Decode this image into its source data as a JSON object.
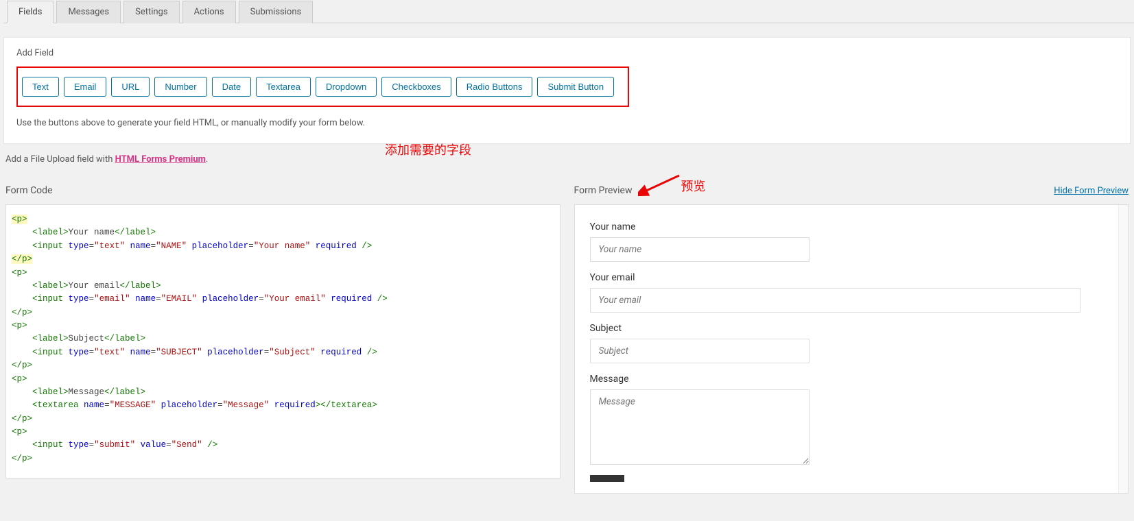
{
  "tabs": [
    "Fields",
    "Messages",
    "Settings",
    "Actions",
    "Submissions"
  ],
  "addField": {
    "title": "Add Field",
    "buttons": [
      "Text",
      "Email",
      "URL",
      "Number",
      "Date",
      "Textarea",
      "Dropdown",
      "Checkboxes",
      "Radio Buttons",
      "Submit Button"
    ],
    "hint": "Use the buttons above to generate your field HTML, or manually modify your form below.",
    "annotation": "添加需要的字段"
  },
  "uploadNote": {
    "prefix": "Add a File Upload field with ",
    "link": "HTML Forms Premium",
    "suffix": "."
  },
  "formCode": {
    "title": "Form Code",
    "code": {
      "name_label": "Your name",
      "name_placeholder": "Your name",
      "email_label": "Your email",
      "email_placeholder": "Your email",
      "subject_label": "Subject",
      "subject_placeholder": "Subject",
      "message_label": "Message",
      "message_placeholder": "Message",
      "submit_value": "Send"
    }
  },
  "formPreview": {
    "title": "Form Preview",
    "hideLink": "Hide Form Preview",
    "annotation": "预览",
    "fields": {
      "name": {
        "label": "Your name",
        "placeholder": "Your name"
      },
      "email": {
        "label": "Your email",
        "placeholder": "Your email"
      },
      "subject": {
        "label": "Subject",
        "placeholder": "Subject"
      },
      "message": {
        "label": "Message",
        "placeholder": "Message"
      }
    }
  }
}
